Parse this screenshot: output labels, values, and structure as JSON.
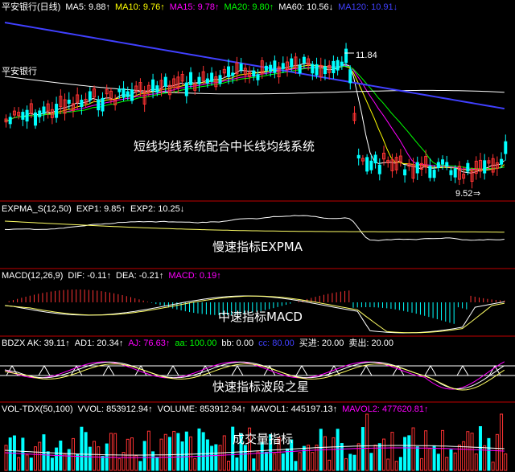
{
  "panels": {
    "main": {
      "header": [
        {
          "text": "平安银行(日线)",
          "color": "#ffffff"
        },
        {
          "text": "MA5: 9.88↑",
          "color": "#ffffff"
        },
        {
          "text": "MA10: 9.76↑",
          "color": "#ffff00"
        },
        {
          "text": "MA15: 9.78↑",
          "color": "#ff00ff"
        },
        {
          "text": "MA20: 9.80↑",
          "color": "#00ff00"
        },
        {
          "text": "MA60: 10.56↓",
          "color": "#ffffff"
        },
        {
          "text": "MA120: 10.91↓",
          "color": "#4040ff"
        }
      ],
      "left_label": "平安银行",
      "high_label": "11.84",
      "low_label": "9.52",
      "caption": "短线均线系统配合中长线均线系统",
      "arrow_glyph": "⇒"
    },
    "expma": {
      "header": [
        {
          "text": "EXPMA_S(12,50)",
          "color": "#ffffff"
        },
        {
          "text": "EXP1: 9.85↑",
          "color": "#ffffff"
        },
        {
          "text": "EXP2: 10.25↓",
          "color": "#ffffff"
        }
      ],
      "caption": "慢速指标EXPMA"
    },
    "macd": {
      "header": [
        {
          "text": "MACD(12,26,9)",
          "color": "#ffffff"
        },
        {
          "text": "DIF: -0.11↑",
          "color": "#ffffff"
        },
        {
          "text": "DEA: -0.21↑",
          "color": "#ffffff"
        },
        {
          "text": "MACD: 0.19↑",
          "color": "#ff00ff"
        }
      ],
      "caption": "中速指标MACD"
    },
    "bdzx": {
      "header": [
        {
          "text": "BDZX AK: 39.11↑",
          "color": "#ffffff"
        },
        {
          "text": "AD1: 20.34↑",
          "color": "#ffffff"
        },
        {
          "text": "AJ: 76.63↑",
          "color": "#ff00ff"
        },
        {
          "text": "aa: 100.00",
          "color": "#00ff00"
        },
        {
          "text": "bb: 0.00",
          "color": "#ffffff"
        },
        {
          "text": "cc: 80.00",
          "color": "#4040ff"
        },
        {
          "text": "买进: 20.00",
          "color": "#ffffff"
        },
        {
          "text": "卖出: 20.00",
          "color": "#ffffff"
        }
      ],
      "caption": "快速指标波段之星"
    },
    "volume": {
      "header": [
        {
          "text": "VOL-TDX(50,100)",
          "color": "#ffffff"
        },
        {
          "text": "VVOL: 853912.94↑",
          "color": "#ffffff"
        },
        {
          "text": "VOLUME: 853912.94↑",
          "color": "#ffffff"
        },
        {
          "text": "MAVOL1: 445197.13↑",
          "color": "#ffffff"
        },
        {
          "text": "MAVOL2: 477620.81↑",
          "color": "#ff00ff"
        }
      ],
      "caption": "成交量指标"
    }
  },
  "colors": {
    "background": "#000000",
    "separator": "#c00000",
    "up": "#ff3333",
    "down": "#00ffff",
    "ma5": "#ffffff",
    "ma10": "#ffff00",
    "ma15": "#ff00ff",
    "ma20": "#00ff00",
    "ma60": "#ffffff",
    "ma120": "#4040ff"
  }
}
